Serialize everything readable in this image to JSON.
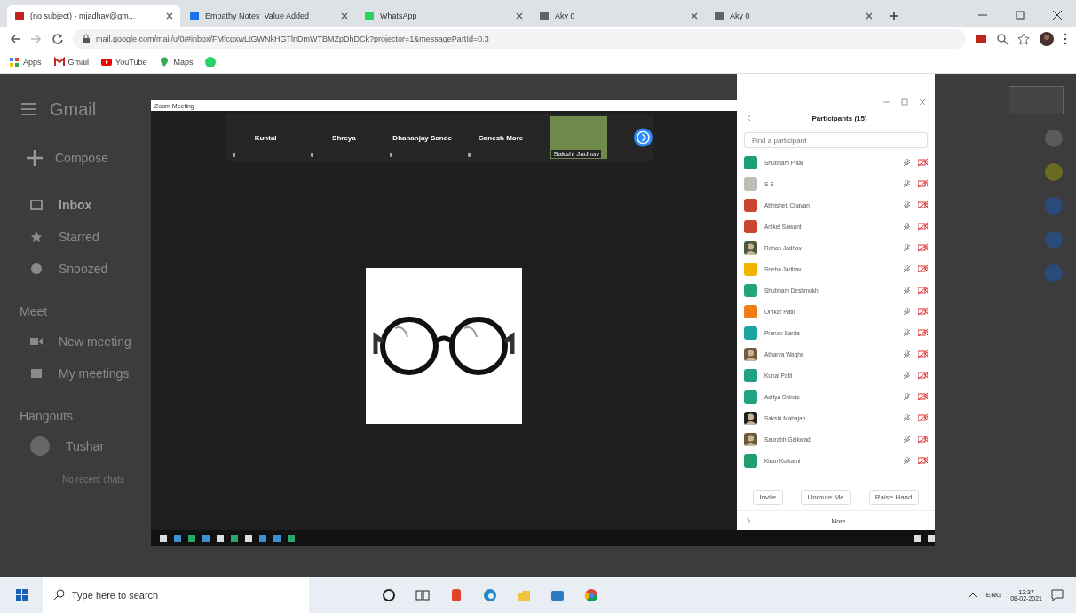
{
  "browser": {
    "tabs": [
      {
        "title": "(no subject) - mjadhav@gm...",
        "selected": true
      },
      {
        "title": "Empathy Notes_Value Added",
        "selected": false
      },
      {
        "title": "WhatsApp",
        "selected": false
      },
      {
        "title": "Aky 0",
        "selected": false
      },
      {
        "title": "Aky 0",
        "selected": false
      }
    ],
    "url": "mail.google.com/mail/u/0/#inbox/FMfcgxwLtGWNkHGTlnDmWTBMZpDhDCk?projector=1&messagePartId=0.3",
    "bookmarks": [
      "Apps",
      "Gmail",
      "YouTube",
      "Maps"
    ]
  },
  "gmail": {
    "logo": "Gmail",
    "compose": "Compose",
    "nav": [
      {
        "label": "Inbox",
        "selected": true
      },
      {
        "label": "Starred",
        "selected": false
      },
      {
        "label": "Snoozed",
        "selected": false
      }
    ],
    "meet_heading": "Meet",
    "meet": [
      "New meeting",
      "My meetings"
    ],
    "hangouts_heading": "Hangouts",
    "hangouts_user": "Tushar",
    "hangouts_note": "No recent chats"
  },
  "zoom": {
    "title": "Zoom Meeting",
    "tiles": [
      {
        "name": "Kuntal"
      },
      {
        "name": "Shreya"
      },
      {
        "name": "Dhananjay Sande"
      },
      {
        "name": "Ganesh More"
      }
    ],
    "self_view": {
      "name": "Sakshi Jadhav"
    }
  },
  "participants": {
    "title": "Participants (15)",
    "search": {
      "placeholder": "Find a participant"
    },
    "people": [
      {
        "name": "Shubham Pillai",
        "kind": "initials",
        "color": "#1e9e78"
      },
      {
        "name": "S S",
        "kind": "initials",
        "color": "#b9bfb4"
      },
      {
        "name": "Abhishek Chavan",
        "kind": "initials",
        "color": "#c8452f"
      },
      {
        "name": "Aniket Sawant",
        "kind": "initials",
        "color": "#c8452f"
      },
      {
        "name": "Rohan Jadhav",
        "kind": "photo",
        "color": "#4a5a3a"
      },
      {
        "name": "Sneha Jadhav",
        "kind": "initials",
        "color": "#f0b400"
      },
      {
        "name": "Shubham Deshmukh",
        "kind": "initials",
        "color": "#23a47c"
      },
      {
        "name": "Omkar Patil",
        "kind": "initials",
        "color": "#f07d16"
      },
      {
        "name": "Pranav Sarde",
        "kind": "initials",
        "color": "#1aa6a0"
      },
      {
        "name": "Atharva Waghe",
        "kind": "photo",
        "color": "#7a5a3e"
      },
      {
        "name": "Kunal Patil",
        "kind": "initials",
        "color": "#20a283"
      },
      {
        "name": "Aditya Shinde",
        "kind": "initials",
        "color": "#20a283"
      },
      {
        "name": "Sakshi Mahajan",
        "kind": "photo",
        "color": "#222222"
      },
      {
        "name": "Saurabh Gaikwad",
        "kind": "photo",
        "color": "#6b5a36"
      },
      {
        "name": "Kiran Kulkarni",
        "kind": "initials",
        "color": "#1f9f6e"
      }
    ],
    "buttons": [
      "Invite",
      "Unmute Me",
      "Raise Hand"
    ],
    "more": "More"
  },
  "taskbar": {
    "search_placeholder": "Type here to search",
    "language": "ENG",
    "time": "12:37",
    "date": "08-02-2021"
  }
}
